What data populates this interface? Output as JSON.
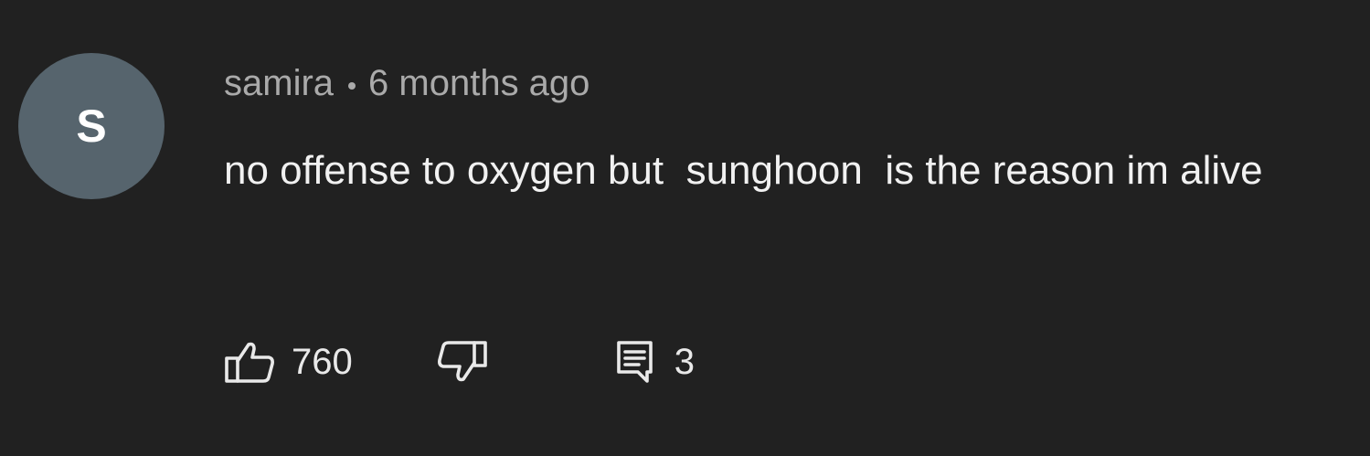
{
  "comment": {
    "avatar_letter": "S",
    "author": "samira",
    "time": "6 months ago",
    "text": "no offense to oxygen but  sunghoon  is the reason im alive",
    "likes": "760",
    "replies": "3"
  },
  "colors": {
    "background": "#212121",
    "avatar_bg": "#56646d",
    "meta_text": "#aaaaaa",
    "body_text": "#f1f1f1"
  },
  "icons": [
    "thumbs-up-icon",
    "thumbs-down-icon",
    "comment-icon"
  ]
}
